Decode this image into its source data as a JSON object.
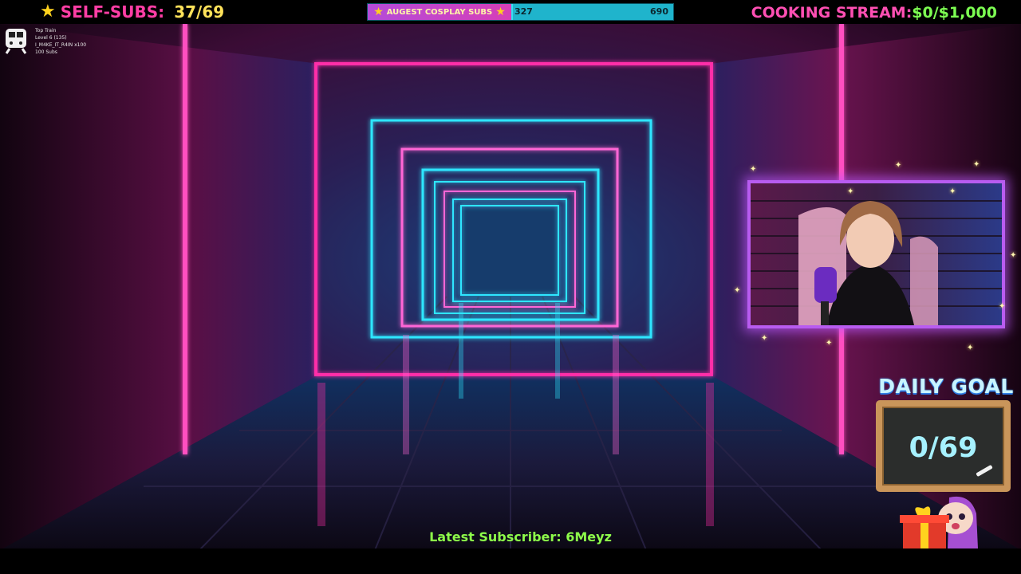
{
  "overlay": {
    "self_subs": {
      "label": "SELF-SUBS:",
      "value": "37/69"
    },
    "sub_goal": {
      "title": "AUGEST COSPLAY SUBS",
      "current": "327",
      "target": "690",
      "progress_fraction": 0.474
    },
    "cooking_stream": {
      "label": "COOKING STREAM:",
      "value": "$0/$1,000"
    },
    "train": {
      "title": "Top Train",
      "level": "Level 6  (135)",
      "user": "I_M4KE_IT_R4IN x100",
      "subs": "100 Subs",
      "icon": "train-icon"
    },
    "daily_goal": {
      "title": "DAILY GOAL",
      "value": "0/69"
    },
    "latest_subscriber": "Latest Subscriber: 6Meyz"
  },
  "colors": {
    "self_subs_label": "#ff3ea5",
    "self_subs_value": "#ffe25a",
    "goal_fill": "#19d3e8",
    "goal_tag": "#c84ad0",
    "cooking_label": "#ff4fb3",
    "cooking_value": "#7dff52",
    "latest_subscriber": "#8dfc4a",
    "webcam_border": "#b85cf0",
    "neon_pink": "#ff2fa8",
    "neon_cyan": "#2ee6ff"
  }
}
